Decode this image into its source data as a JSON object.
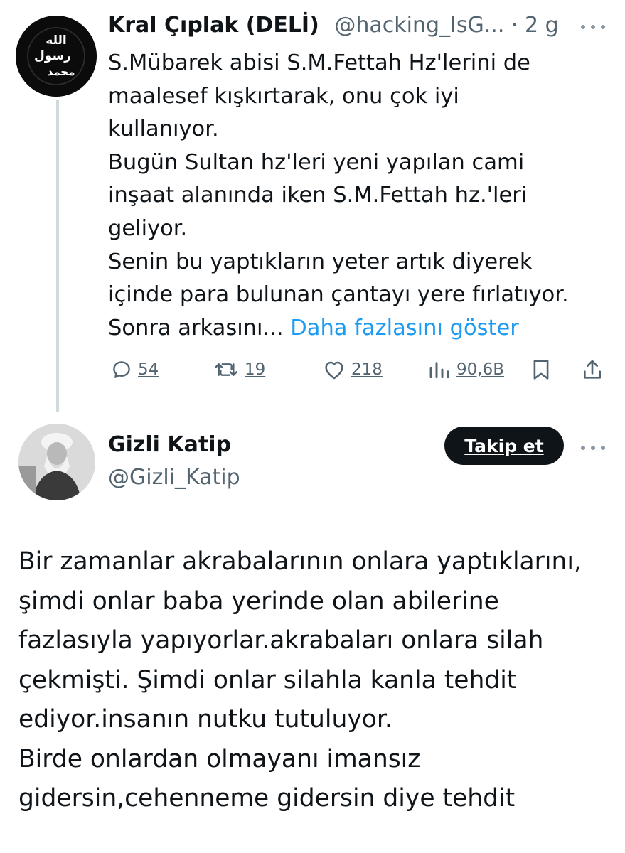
{
  "tweet1": {
    "author_name": "Kral Çıplak (DELİ)",
    "handle": "@hacking_IsG...",
    "separator": " · ",
    "time": "2 g",
    "avatar_text": [
      "الله",
      "رسول",
      "محمد"
    ],
    "body": "S.Mübarek abisi S.M.Fettah Hz'lerini de\nmaalesef kışkırtarak, onu çok iyi\nkullanıyor.\nBugün Sultan hz'leri yeni yapılan cami\ninşaat alanında iken S.M.Fettah hz.'leri\ngeliyor.\nSenin bu yaptıkların yeter artık diyerek\niçinde para bulunan çantayı yere fırlatıyor.\nSonra arkasını... ",
    "show_more": "Daha fazlasını göster",
    "replies": "54",
    "retweets": "19",
    "likes": "218",
    "views": "90,6B"
  },
  "tweet2": {
    "author_name": "Gizli Katip",
    "handle": "@Gizli_Katip",
    "follow_label": "Takip et",
    "body": "Bir zamanlar akrabalarının onlara yaptıklarını,\nşimdi onlar baba yerinde olan abilerine\nfazlasıyla yapıyorlar.akrabaları onlara silah\nçekmişti. Şimdi onlar silahla kanla tehdit\nediyor.insanın nutku tutuluyor.\nBirde onlardan olmayanı imansız\ngidersin,cehenneme gidersin diye tehdit"
  },
  "icons": [
    "reply-icon",
    "retweet-icon",
    "like-icon",
    "views-icon",
    "bookmark-icon",
    "share-icon",
    "more-icon"
  ],
  "colors": {
    "link": "#1d9bf0",
    "muted": "#536471",
    "thread_line": "#cfd9de",
    "button_bg": "#0f1419"
  }
}
